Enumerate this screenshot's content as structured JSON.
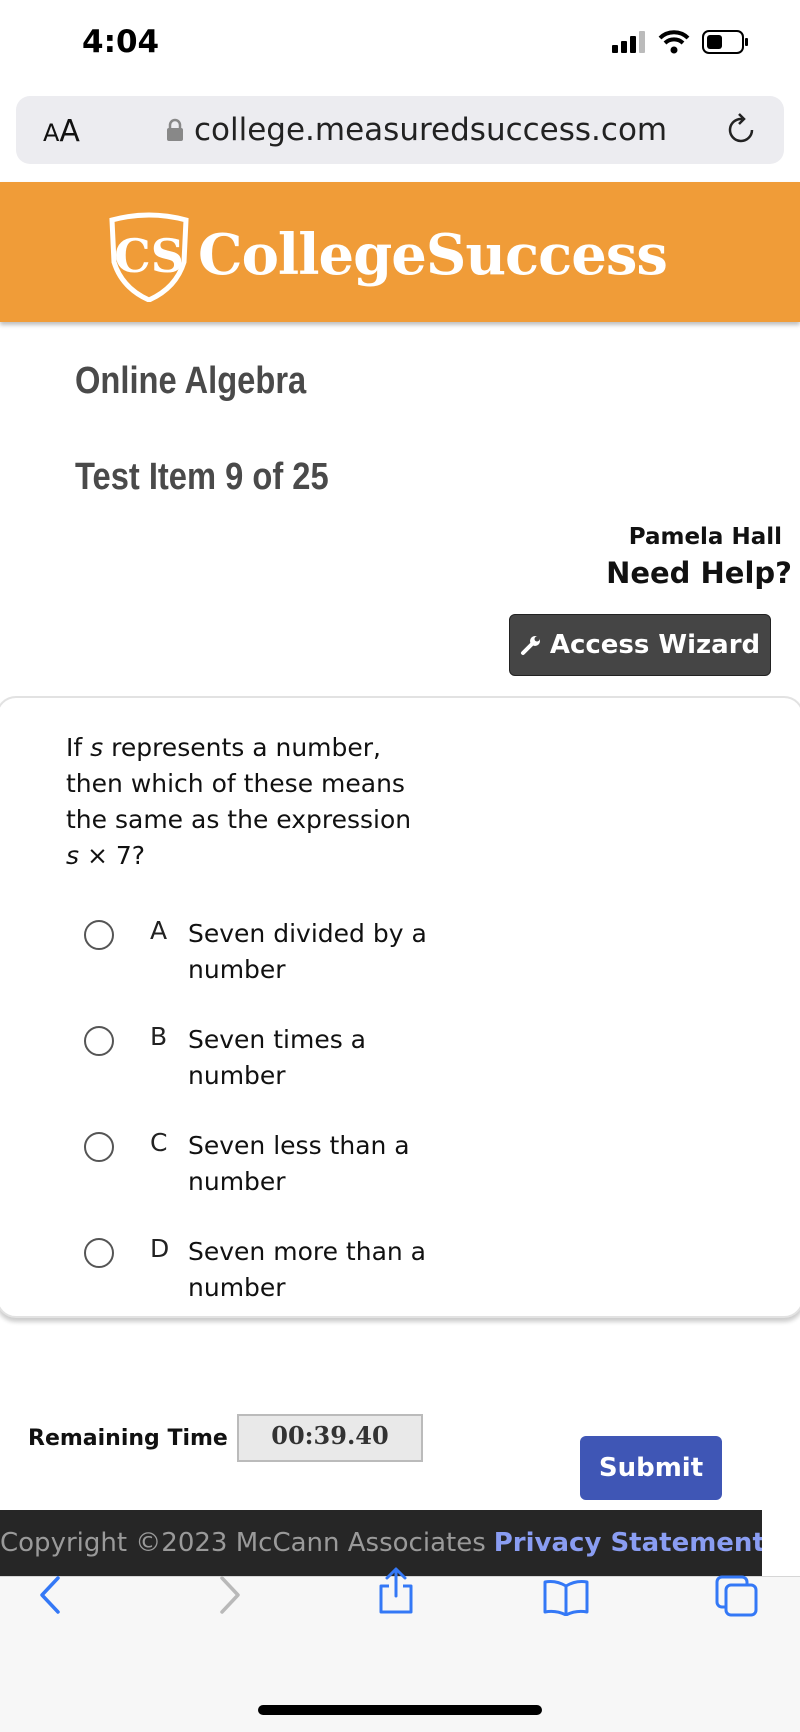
{
  "status_bar": {
    "time": "4:04"
  },
  "browser": {
    "text_size_label_small": "A",
    "text_size_label_big": "A",
    "url": "college.measuredsuccess.com"
  },
  "brand": {
    "name": "CollegeSuccess",
    "logo_initials": "CS",
    "color": "#f09c38"
  },
  "page": {
    "course_title": "Online Algebra",
    "item_title": "Test Item 9 of 25",
    "user_name": "Pamela Hall",
    "need_help": "Need Help?",
    "access_wizard_label": "Access Wizard"
  },
  "question": {
    "text_prefix": "If ",
    "var": "s",
    "text_middle": " represents a number, then which of these means the same as the expression ",
    "expr_var": "s",
    "expr_rest": " × 7?",
    "choices": [
      {
        "letter": "A",
        "text": "Seven divided by a number"
      },
      {
        "letter": "B",
        "text": "Seven times a number"
      },
      {
        "letter": "C",
        "text": "Seven less than a number"
      },
      {
        "letter": "D",
        "text": "Seven more than a number"
      }
    ]
  },
  "timer": {
    "label": "Remaining Time",
    "value": "00:39.40"
  },
  "submit_label": "Submit",
  "footer": {
    "copyright": "Copyright ©2023 McCann Associates",
    "privacy": "Privacy Statement",
    "separator": "|"
  },
  "colors": {
    "submit": "#3f56b5",
    "footer_bg": "#262626",
    "link": "#8a9df2"
  }
}
